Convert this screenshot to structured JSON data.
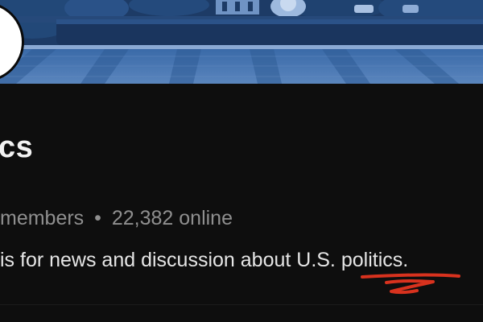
{
  "community": {
    "title": "cs",
    "members_label": " members",
    "separator": "•",
    "online_count": "22,382 online",
    "description": "is for news and discussion about U.S. politics."
  },
  "colors": {
    "background": "#0e0e0e",
    "banner_tint": "#2f5c96",
    "annotation_red": "#d8321e"
  }
}
